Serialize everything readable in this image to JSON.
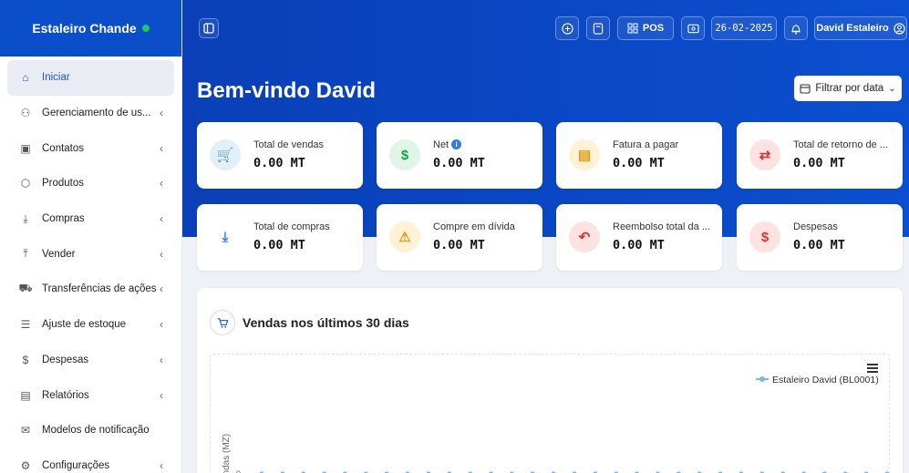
{
  "brand": {
    "name": "Estaleiro Chande",
    "status_color": "#22c55e"
  },
  "sidebar": {
    "items": [
      {
        "label": "Iniciar",
        "icon": "home-icon",
        "chevron": false,
        "active": true
      },
      {
        "label": "Gerenciamento de us...",
        "icon": "users-icon",
        "chevron": true
      },
      {
        "label": "Contatos",
        "icon": "contacts-icon",
        "chevron": true
      },
      {
        "label": "Produtos",
        "icon": "box-icon",
        "chevron": true
      },
      {
        "label": "Compras",
        "icon": "download-icon",
        "chevron": true
      },
      {
        "label": "Vender",
        "icon": "upload-icon",
        "chevron": true
      },
      {
        "label": "Transferências de ações",
        "icon": "truck-icon",
        "chevron": true
      },
      {
        "label": "Ajuste de estoque",
        "icon": "database-icon",
        "chevron": true
      },
      {
        "label": "Despesas",
        "icon": "dollar-icon",
        "chevron": true
      },
      {
        "label": "Relatórios",
        "icon": "report-icon",
        "chevron": true
      },
      {
        "label": "Modelos de notificação",
        "icon": "mail-icon",
        "chevron": false
      },
      {
        "label": "Configurações",
        "icon": "gear-icon",
        "chevron": true
      }
    ]
  },
  "topbar": {
    "pos_label": "POS",
    "date": "26-02-2025",
    "user": "David Estaleiro"
  },
  "header": {
    "welcome": "Bem-vindo David",
    "filter_label": "Filtrar por data"
  },
  "cards": [
    {
      "label": "Total de vendas",
      "value": "0.00 MT",
      "icon": "cart-icon",
      "bg": "#e0f0fb",
      "fg": "#2f7de1",
      "glyph": "🛒"
    },
    {
      "label": "Net",
      "value": "0.00 MT",
      "icon": "money-icon",
      "bg": "#dff5e8",
      "fg": "#16a34a",
      "glyph": "$",
      "info": true
    },
    {
      "label": "Fatura a pagar",
      "value": "0.00 MT",
      "icon": "invoice-icon",
      "bg": "#fdf1d6",
      "fg": "#e59a0b",
      "glyph": "▤"
    },
    {
      "label": "Total de retorno de ...",
      "value": "0.00 MT",
      "icon": "exchange-icon",
      "bg": "#fde2e2",
      "fg": "#e03131",
      "glyph": "⇄"
    },
    {
      "label": "Total de compras",
      "value": "0.00 MT",
      "icon": "download-icon",
      "bg": "#ffffff",
      "fg": "#2f7de1",
      "glyph": "⤓"
    },
    {
      "label": "Compre em dívida",
      "value": "0.00 MT",
      "icon": "warning-icon",
      "bg": "#fdf1d6",
      "fg": "#e59a0b",
      "glyph": "⚠"
    },
    {
      "label": "Reembolso total da ...",
      "value": "0.00 MT",
      "icon": "refund-icon",
      "bg": "#fde2e2",
      "fg": "#e03131",
      "glyph": "↶"
    },
    {
      "label": "Despesas",
      "value": "0.00 MT",
      "icon": "money-icon",
      "bg": "#fde2e2",
      "fg": "#e03131",
      "glyph": "$"
    }
  ],
  "chart_panel": {
    "title": "Vendas nos últimos 30 dias"
  },
  "chart_data": {
    "type": "line",
    "legend": "Estaleiro David (BL0001)",
    "legend_position": "top-right",
    "ylabel": "endas (MZ)",
    "y_tick": "0",
    "series": [
      {
        "name": "Estaleiro David (BL0001)",
        "color": "#7cb5ec",
        "values": [
          0,
          0,
          0,
          0,
          0,
          0,
          0,
          0,
          0,
          0,
          0,
          0,
          0,
          0,
          0,
          0,
          0,
          0,
          0,
          0,
          0,
          0,
          0,
          0,
          0,
          0,
          0,
          0,
          0,
          0,
          0
        ]
      }
    ]
  }
}
